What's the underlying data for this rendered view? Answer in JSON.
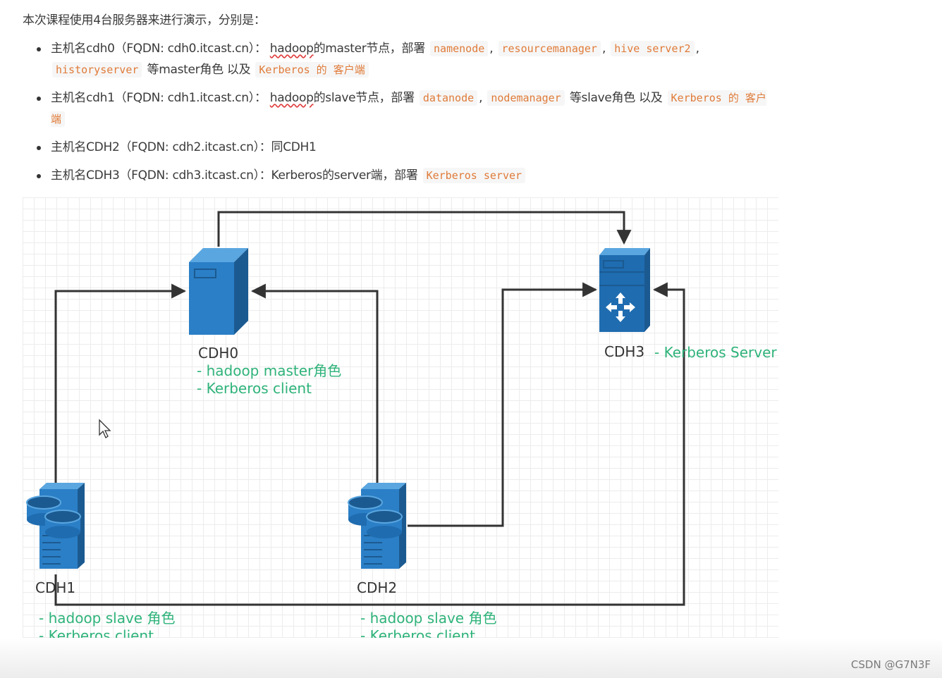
{
  "intro": "本次课程使用4台服务器来进行演示，分别是：",
  "bullets": [
    {
      "prefix": "主机名cdh0（FQDN: cdh0.itcast.cn）：",
      "hadoop": "hadoop",
      "desc": "的master节点，部署",
      "codes": [
        "namenode",
        "resourcemanager",
        "hive server2",
        "historyserver"
      ],
      "mid": "等master角色 以及",
      "code_tail": "Kerberos 的 客户端"
    },
    {
      "prefix": "主机名cdh1（FQDN: cdh1.itcast.cn）：",
      "hadoop": "hadoop",
      "desc": "的slave节点，部署",
      "codes": [
        "datanode",
        "nodemanager"
      ],
      "mid": "等slave角色 以及",
      "code_tail": "Kerberos 的 客户端"
    },
    {
      "text": "主机名CDH2（FQDN: cdh2.itcast.cn）：同CDH1"
    },
    {
      "text": "主机名CDH3（FQDN: cdh3.itcast.cn）：Kerberos的server端，部署",
      "code": "Kerberos server"
    }
  ],
  "diagram": {
    "nodes": {
      "cdh0": {
        "name": "CDH0",
        "roles": [
          "- hadoop master角色",
          "- Kerberos client"
        ]
      },
      "cdh1": {
        "name": "CDH1",
        "roles": [
          "- hadoop slave 角色",
          "- Kerberos client"
        ]
      },
      "cdh2": {
        "name": "CDH2",
        "roles": [
          "- hadoop slave 角色",
          "- Kerberos client"
        ]
      },
      "cdh3": {
        "name": "CDH3",
        "roles": [
          "- Kerberos Server"
        ]
      }
    },
    "colors": {
      "server_blue": "#2b7fc6",
      "server_dark": "#1b5a91",
      "server_light": "#5aa6e0",
      "role_green": "#2fb37a",
      "arrow": "#333333"
    }
  },
  "watermark": "CSDN @G7N3F"
}
